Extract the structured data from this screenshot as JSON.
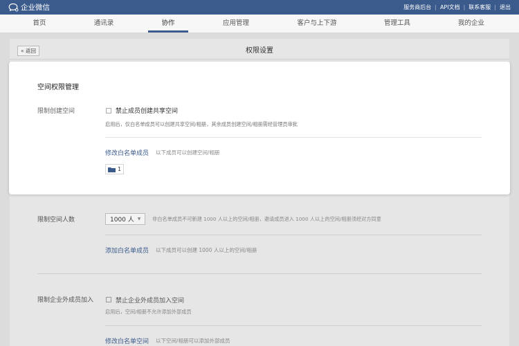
{
  "app": {
    "title": "企业微信"
  },
  "top_links": [
    "服务商后台",
    "API文档",
    "联系客服",
    "退出"
  ],
  "nav": {
    "items": [
      "首页",
      "通讯录",
      "协作",
      "应用管理",
      "客户与上下游",
      "管理工具",
      "我的企业"
    ],
    "active_index": 2
  },
  "subpage": {
    "back_label": "« 返回",
    "title": "权限设置"
  },
  "section": {
    "title": "空间权限管理"
  },
  "create_limit": {
    "label": "限制创建空间",
    "checkbox_label": "禁止成员创建共享空间",
    "checked": false,
    "desc": "启用后，仅白名单成员可以创建共享空间/相册，其余成员创建空间/相册需经管理员审批",
    "whitelist_link": "修改白名单成员",
    "whitelist_hint": "以下成员可以创建空间/相册",
    "whitelist_count": "1"
  },
  "size_limit": {
    "label": "限制空间人数",
    "select_value": "1000 人",
    "desc": "非白名单成员不可新建 1000 人以上的空间/相册，邀请成员进入 1000 人以上的空间/相册须经对方同意",
    "whitelist_link": "添加白名单成员",
    "whitelist_hint": "以下成员可以创建 1000 人以上的空间/相册"
  },
  "external_limit": {
    "label": "限制企业外成员加入",
    "checkbox_label": "禁止企业外成员加入空间",
    "checked": false,
    "desc": "启用后，空间/相册不允许添加外部成员",
    "whitelist_link": "修改白名单空间",
    "whitelist_hint": "以下空间/相册可以添加外部成员"
  },
  "colors": {
    "brand": "#3b5b8c",
    "link": "#3b5b8c",
    "overlay_bg": "#dcdcdc",
    "card_bg": "#ffffff"
  }
}
